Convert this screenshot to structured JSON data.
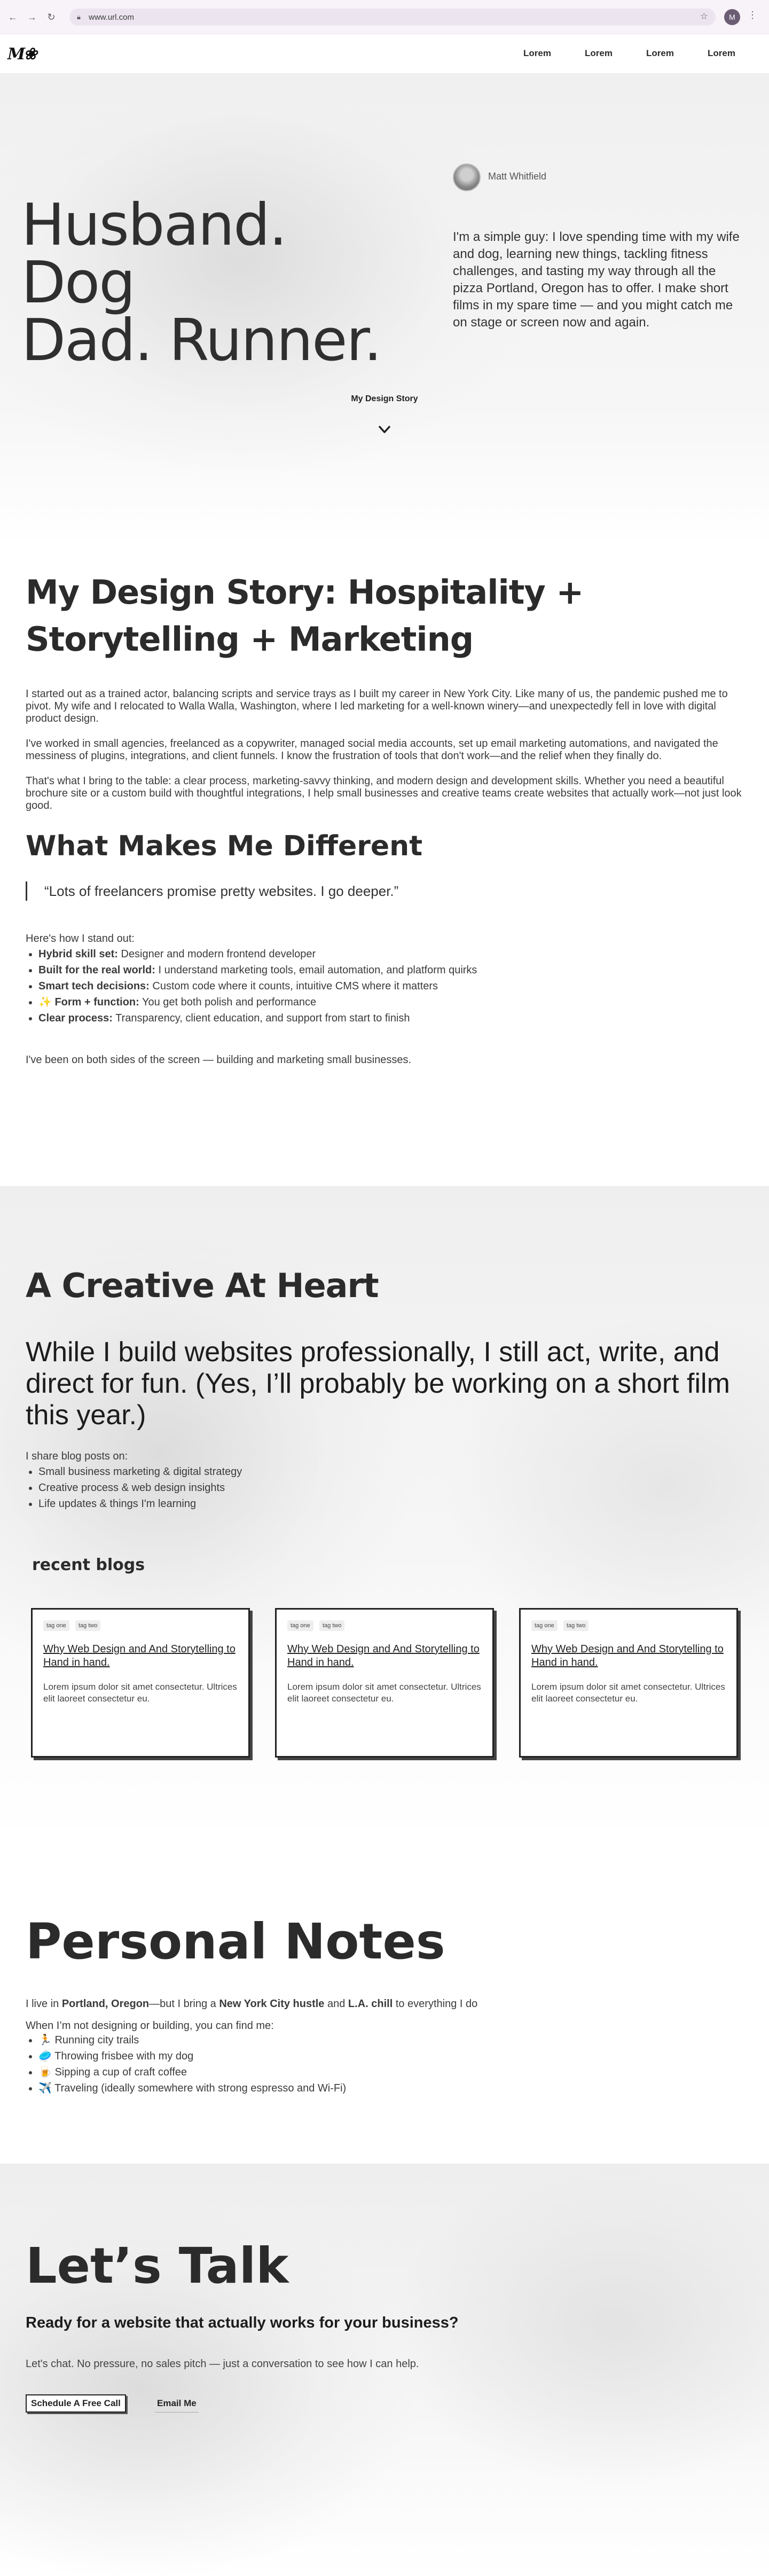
{
  "browser": {
    "url": "www.url.com",
    "profile_initial": "M",
    "icons": [
      "back-arrow-icon",
      "forward-arrow-icon",
      "reload-icon",
      "lock-icon",
      "bookmark-star-icon",
      "kebab-menu-icon"
    ]
  },
  "header": {
    "logo": "M❀",
    "nav": [
      "Lorem",
      "Lorem",
      "Lorem",
      "Lorem"
    ]
  },
  "hero": {
    "title_line1": "Husband. Dog",
    "title_line2": "Dad. Runner.",
    "author": "Matt Whitfield",
    "intro": "I'm a simple guy: I love spending time with my wife and dog, learning new things, tackling fitness challenges, and tasting my way through all the pizza Portland, Oregon has to offer. I make short films in my spare time — and you might catch me on stage or screen now and again.",
    "story_link": "My Design Story"
  },
  "story": {
    "heading": "My Design Story: Hospitality  + Storytelling + Marketing",
    "paragraphs": [
      "I started out as a trained actor, balancing scripts and service trays as I built my career in New York City. Like many of us, the pandemic pushed me to pivot. My wife and I relocated to Walla Walla, Washington, where I led marketing for a well-known winery—and unexpectedly fell in love with digital product design.",
      "I've worked in small agencies, freelanced as a copywriter, managed social media accounts, set up email marketing automations, and navigated the messiness of plugins, integrations, and client funnels. I know the frustration of tools that don't work—and the relief when they finally do.",
      "That's what I bring to the table: a clear process, marketing-savvy thinking, and modern design and development skills. Whether you need a beautiful brochure site or a custom build with thoughtful integrations, I help small businesses and creative teams create websites that actually work—not just look good."
    ],
    "different_heading": "What Makes Me Different",
    "quote": "“Lots of freelancers promise pretty websites. I go deeper.”",
    "standout_intro": "Here's how I stand out:",
    "standout": [
      {
        "icon": "",
        "label": "Hybrid skill set:",
        "text": " Designer and modern frontend developer"
      },
      {
        "icon": "",
        "label": "Built for the real world:",
        "text": " I understand marketing tools, email automation, and platform quirks"
      },
      {
        "icon": "",
        "label": "Smart tech decisions:",
        "text": " Custom code where it counts, intuitive CMS where it matters"
      },
      {
        "icon": "✨ ",
        "label": "Form + function:",
        "text": " You get both polish and performance"
      },
      {
        "icon": "",
        "label": "Clear process:",
        "text": " Transparency, client education, and support from start to finish"
      }
    ],
    "closing": "I've been on both sides of the screen — building and marketing small businesses."
  },
  "creative": {
    "heading": "A Creative At Heart",
    "big": "While I build websites professionally, I still act, write, and direct for fun. (Yes, I’ll probably be working on a short film this year.)",
    "blog_intro": "I share blog posts on:",
    "topics": [
      "Small business marketing & digital strategy",
      "Creative process & web design insights",
      "Life updates & things I'm learning"
    ],
    "recent_heading": "recent blogs",
    "cards": [
      {
        "tags": [
          "tag one",
          "tag two"
        ],
        "title": "Why Web Design and And Storytelling to Hand in hand.",
        "desc": "Lorem ipsum dolor sit amet consectetur. Ultrices elit laoreet consectetur eu."
      },
      {
        "tags": [
          "tag one",
          "tag two"
        ],
        "title": "Why Web Design and And Storytelling to Hand in hand.",
        "desc": "Lorem ipsum dolor sit amet consectetur. Ultrices elit laoreet consectetur eu."
      },
      {
        "tags": [
          "tag one",
          "tag two"
        ],
        "title": "Why Web Design and And Storytelling to Hand in hand.",
        "desc": "Lorem ipsum dolor sit amet consectetur. Ultrices elit laoreet consectetur eu."
      }
    ]
  },
  "notes": {
    "heading": "Personal Notes",
    "line_parts": [
      "I live in ",
      "Portland, Oregon",
      "—but I bring a ",
      "New York City hustle",
      " and ",
      "L.A. chill",
      " to everything I do"
    ],
    "find_intro": "When I’m not designing or building, you can find me:",
    "items": [
      "🏃 Running city trails",
      "🥏 Throwing frisbee with my dog",
      "🍺 Sipping a cup of craft coffee",
      "✈️ Traveling (ideally somewhere with strong espresso and Wi-Fi)"
    ]
  },
  "talk": {
    "heading": "Let’s Talk",
    "subheading": "Ready for a website that actually works for your business?",
    "text": "Let's chat. No pressure, no sales pitch — just a conversation to see how I can help.",
    "primary_button": "Schedule A Free Call",
    "secondary_button": "Email Me"
  }
}
